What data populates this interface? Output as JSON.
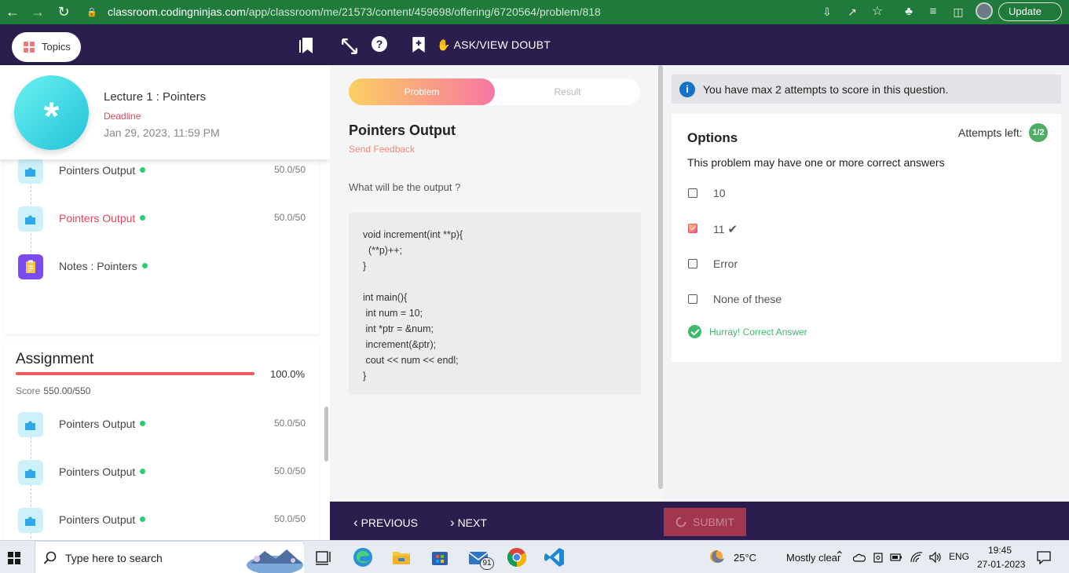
{
  "browser": {
    "url_host": "classroom.codingninjas.com",
    "url_path": "/app/classroom/me/21573/content/459698/offering/6720564/problem/818",
    "update_label": "Update"
  },
  "sidebar": {
    "topics_label": "Topics",
    "lecture": {
      "title": "Lecture 1 : Pointers",
      "deadline_label": "Deadline",
      "deadline_date": "Jan 29, 2023, 11:59 PM"
    },
    "items": [
      {
        "label": "Pointers Output",
        "score": "50.0/50",
        "active": false
      },
      {
        "label": "Pointers Output",
        "score": "50.0/50",
        "active": true
      },
      {
        "label": "Notes : Pointers",
        "score": "",
        "active": false
      }
    ],
    "assignment": {
      "title": "Assignment",
      "percent": "100.0%",
      "progress": 1.0,
      "score_label": "Score",
      "score_value": "550.00/550",
      "items": [
        {
          "label": "Pointers Output",
          "score": "50.0/50"
        },
        {
          "label": "Pointers Output",
          "score": "50.0/50"
        },
        {
          "label": "Pointers Output",
          "score": "50.0/50"
        }
      ]
    }
  },
  "toolbar": {
    "ask_doubt_label": "ASK/VIEW DOUBT"
  },
  "problem": {
    "tab_problem": "Problem",
    "tab_result": "Result",
    "title": "Pointers Output",
    "feedback_link": "Send Feedback",
    "question": "What will be the output ?",
    "code": [
      "void increment(int **p){",
      "  (**p)++;",
      "}",
      "",
      "int main(){",
      " int num = 10;",
      " int *ptr = &num;",
      " increment(&ptr);",
      " cout << num << endl;",
      "}"
    ]
  },
  "answer": {
    "info_text": "You have max 2 attempts to score in this question.",
    "options_title": "Options",
    "attempts_label": "Attempts left:",
    "attempts_value": "1/2",
    "subtitle": "This problem may have one or more correct answers",
    "options": [
      {
        "label": "10",
        "checked": false
      },
      {
        "label": "11",
        "checked": true
      },
      {
        "label": "Error",
        "checked": false
      },
      {
        "label": "None of these",
        "checked": false
      }
    ],
    "result_text": "Hurray! Correct Answer"
  },
  "bottom_nav": {
    "previous_label": "PREVIOUS",
    "next_label": "NEXT",
    "submit_label": "SUBMIT"
  },
  "taskbar": {
    "search_placeholder": "Type here to search",
    "mail_badge": "91",
    "weather_temp": "25°C",
    "weather_desc": "Mostly clear",
    "language": "ENG",
    "time": "19:45",
    "date": "27-01-2023"
  },
  "colors": {
    "brand_dark": "#2b1e4e",
    "accent_pink": "#e0455e",
    "success_green": "#3cb96b"
  }
}
